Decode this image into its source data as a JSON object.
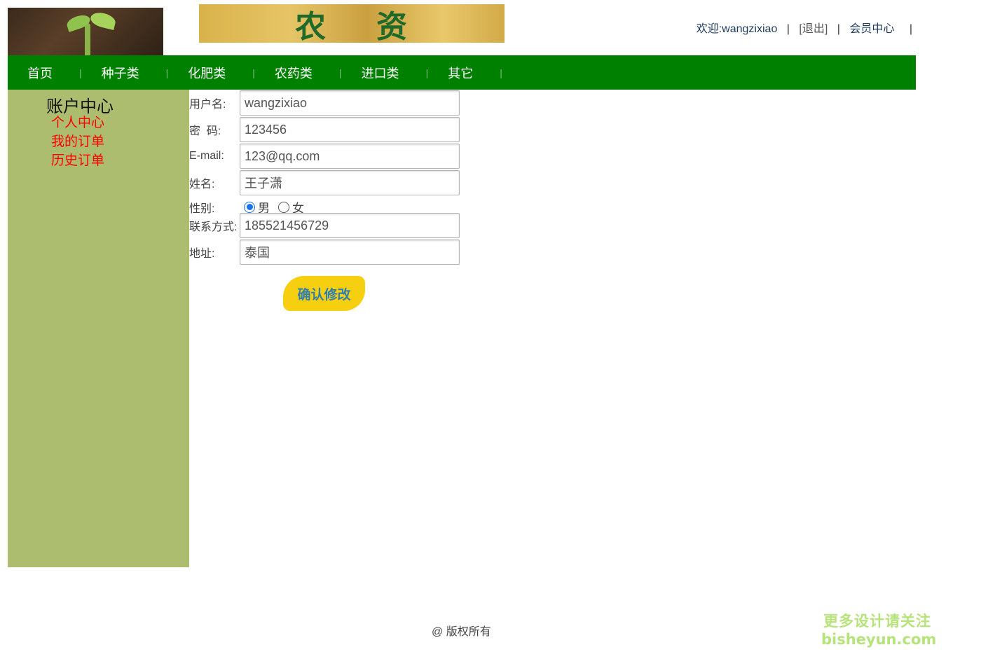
{
  "header": {
    "banner_chars": [
      "农",
      "资"
    ],
    "user_bar": {
      "welcome": "欢迎:wangzixiao",
      "separator": "|",
      "logout": "[退出]",
      "member_center": "会员中心"
    }
  },
  "nav": {
    "items": [
      {
        "label": "首页"
      },
      {
        "label": "种子类"
      },
      {
        "label": "化肥类"
      },
      {
        "label": "农药类"
      },
      {
        "label": "进口类"
      },
      {
        "label": "其它"
      }
    ],
    "divider": "|"
  },
  "sidebar": {
    "title": "账户中心",
    "links": [
      {
        "label": "个人中心"
      },
      {
        "label": "我的订单"
      },
      {
        "label": "历史订单"
      }
    ]
  },
  "form": {
    "username": {
      "label": "用户名:",
      "value": "wangzixiao"
    },
    "password": {
      "label": "密  码:",
      "value": "123456"
    },
    "email": {
      "label": "E-mail:",
      "value": "123@qq.com"
    },
    "name": {
      "label": "姓名:",
      "value": "王子潇"
    },
    "gender": {
      "label": "性别:",
      "options": [
        "男",
        "女"
      ],
      "selected": "男"
    },
    "phone": {
      "label": "联系方式:",
      "value": "185521456729"
    },
    "address": {
      "label": "地址:",
      "value": "泰国"
    },
    "submit_label": "确认修改"
  },
  "footer": {
    "copyright": "@ 版权所有"
  },
  "watermark": {
    "line1": "更多设计请关注",
    "line2": "bisheyun.com"
  },
  "colors": {
    "nav_bg": "#008000",
    "sidebar_bg": "#adbd6f",
    "sidebar_link": "#ff0000",
    "button_bg": "#f5cf10",
    "button_text": "#2f7fb0"
  }
}
